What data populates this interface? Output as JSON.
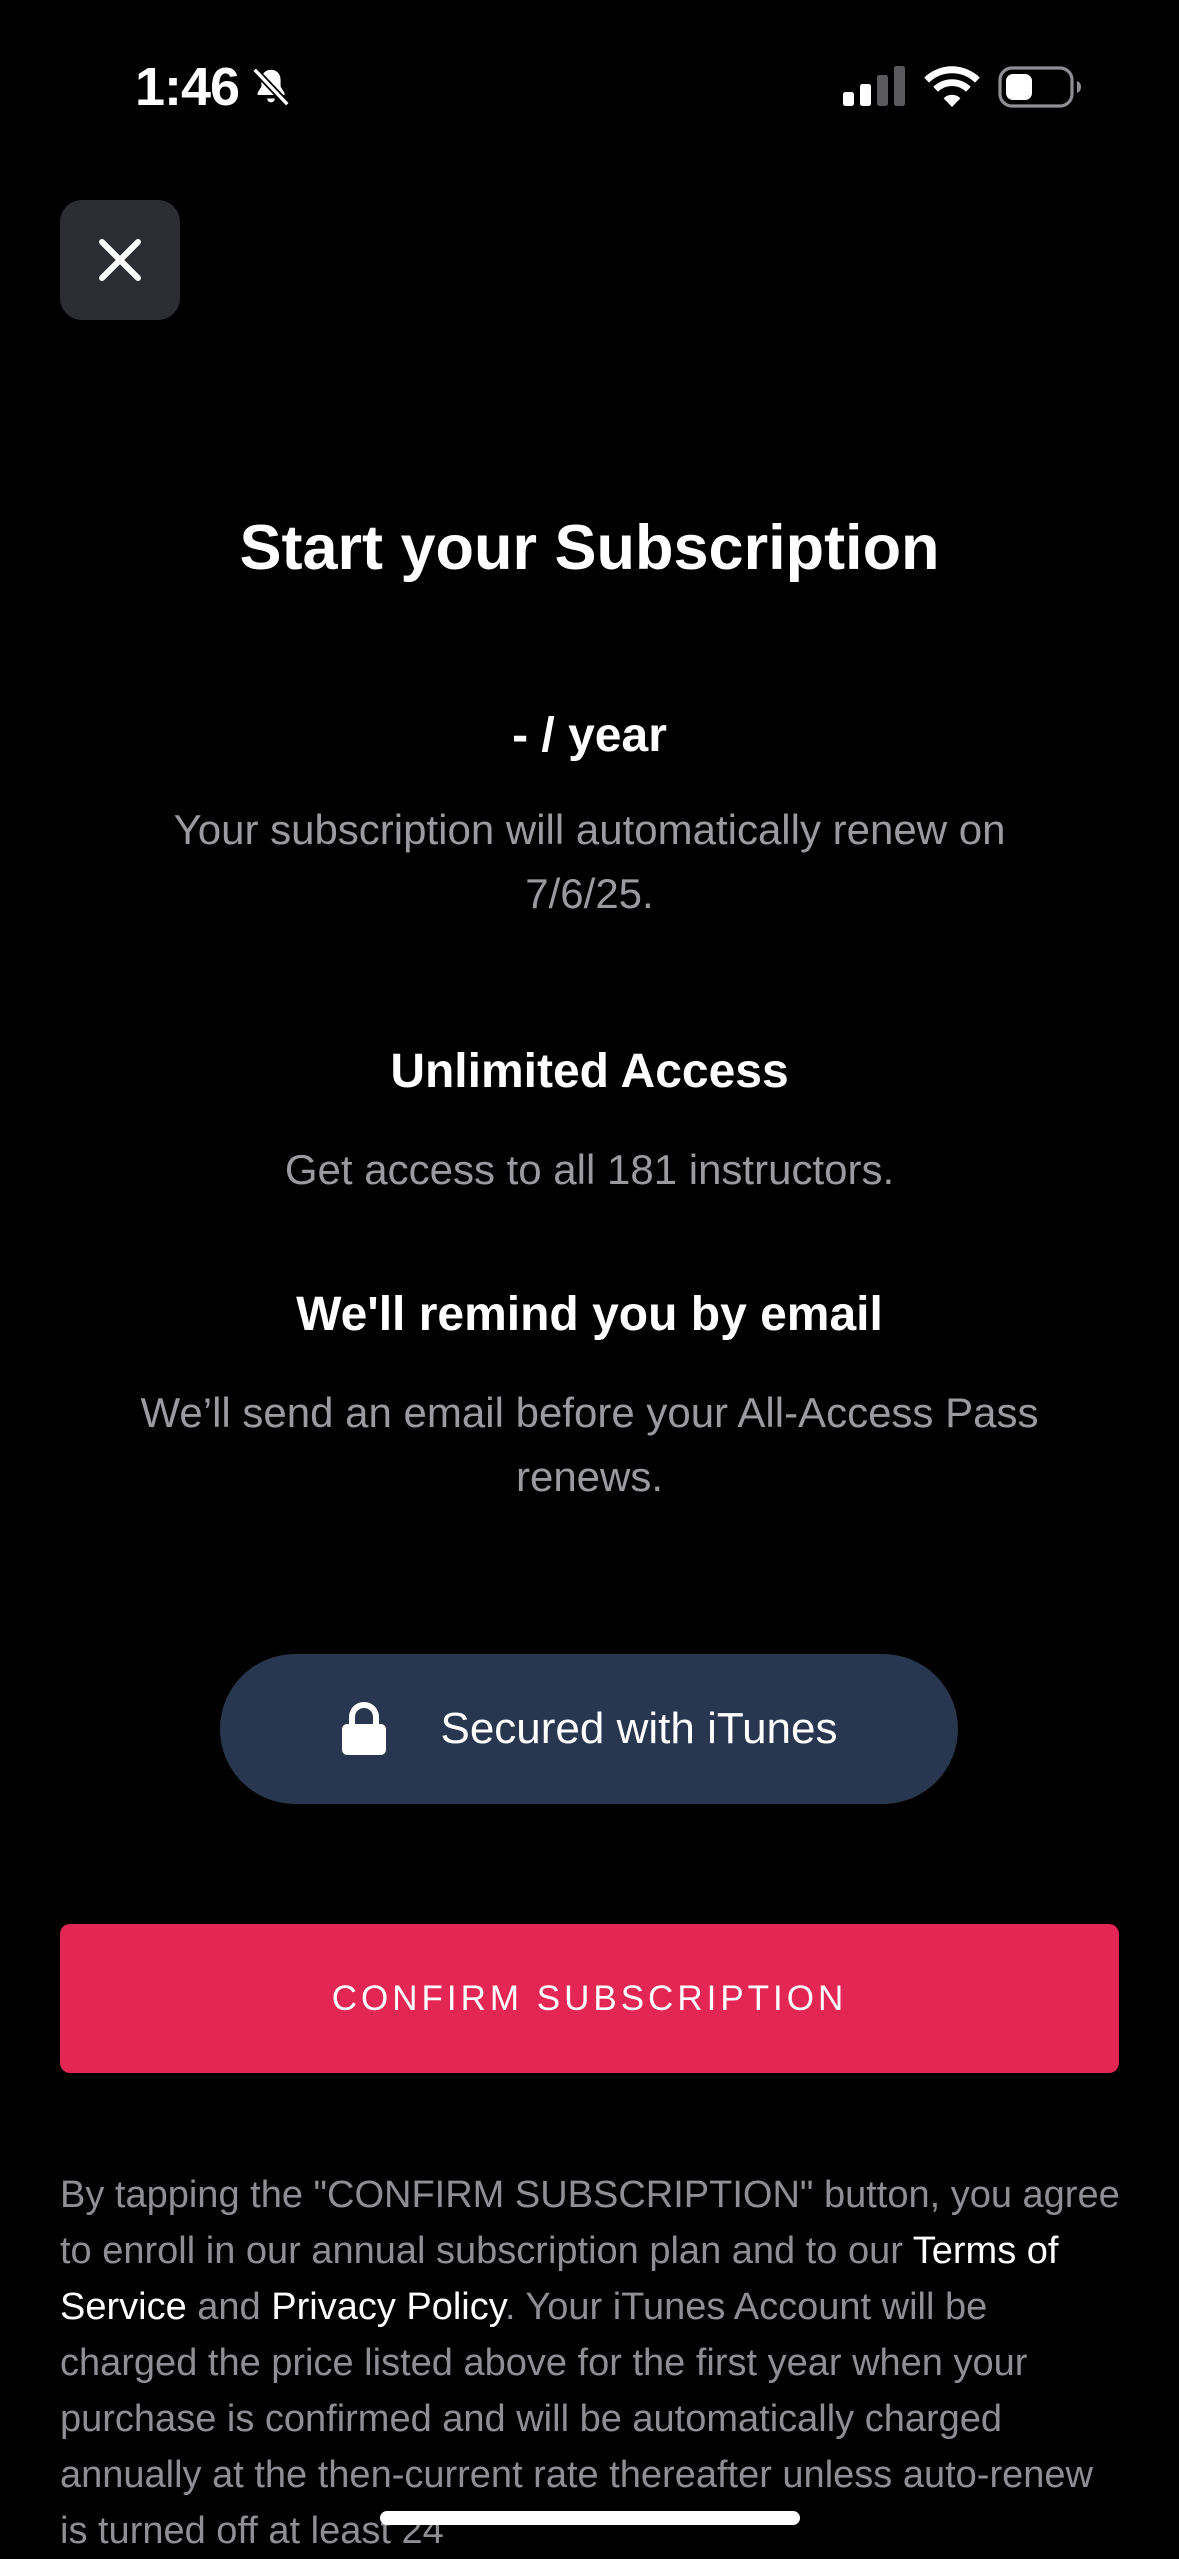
{
  "status_bar": {
    "time": "1:46"
  },
  "header": {
    "title": "Start your Subscription"
  },
  "plan": {
    "price": "- / year",
    "renew_text": "Your subscription will automatically renew on 7/6/25."
  },
  "features": [
    {
      "title": "Unlimited Access",
      "description": "Get access to all 181 instructors."
    },
    {
      "title": "We'll remind you by email",
      "description": "We’ll send an email before your All-Access Pass renews."
    }
  ],
  "secured": {
    "label": "Secured with iTunes",
    "icon": "lock-icon"
  },
  "confirm": {
    "label": "CONFIRM SUBSCRIPTION"
  },
  "legal": {
    "part1": "By tapping the \"CONFIRM SUBSCRIPTION\" button, you agree to enroll in our annual subscription plan and to our ",
    "terms_link": "Terms of Service",
    "and": " and ",
    "privacy_link": "Privacy Policy",
    "part2": ". Your iTunes Account will be charged the price listed above for the first year when your purchase is confirmed and will be automatically charged annually at the then-current rate thereafter unless auto-renew is turned off at least 24"
  },
  "colors": {
    "background": "#000000",
    "accent": "#e32653",
    "pill": "#28374f",
    "muted_text": "#9a9a9f"
  }
}
